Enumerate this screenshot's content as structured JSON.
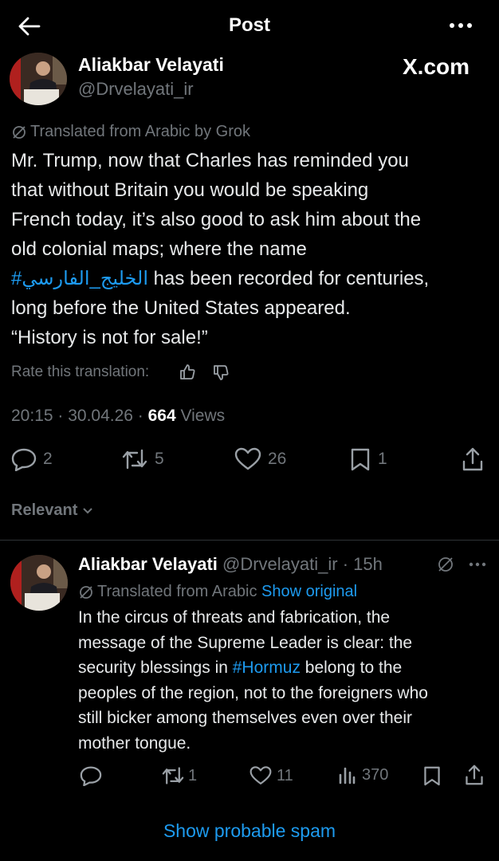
{
  "header": {
    "title": "Post"
  },
  "post": {
    "author_name": "Aliakbar Velayati",
    "author_handle": "@Drvelayati_ir",
    "brand": "X.com",
    "translated_label": "Translated from Arabic by Grok",
    "text_lines": [
      "Mr. Trump, now that Charles has reminded you",
      "that without Britain you would be speaking",
      "French today, it’s also good to ask him about the",
      "old colonial maps; where the name"
    ],
    "hashtag": "#الخليج_الفارسي",
    "line5_rest": " has been recorded for centuries,",
    "text_lines_end": [
      "long before the United States appeared.",
      "“History is not for sale!”"
    ],
    "rate_label": "Rate this translation:",
    "time": "20:15 · 30.04.26 · ",
    "views_count": "664",
    "views_label": " Views",
    "stats": {
      "replies": "2",
      "reposts": "5",
      "likes": "26",
      "bookmarks": "1"
    }
  },
  "filter": {
    "label": "Relevant"
  },
  "reply": {
    "author_name": "Aliakbar Velayati",
    "meta": " @Drvelayati_ir · 15h",
    "translated_label": "Translated from Arabic",
    "show_original": "Show original",
    "line1": "In the circus of threats and fabrication, the",
    "line2": "message of the Supreme Leader is clear: the",
    "line3_a": "security blessings in ",
    "hashtag": "#Hormuz",
    "line3_b": " belong to the",
    "line4": "peoples of the region, not to the foreigners who",
    "line5": "still bicker among themselves even over their",
    "line6": "mother tongue.",
    "stats": {
      "reposts": "1",
      "likes": "11",
      "views": "370"
    }
  },
  "footer": {
    "spam_label": "Show probable spam"
  }
}
